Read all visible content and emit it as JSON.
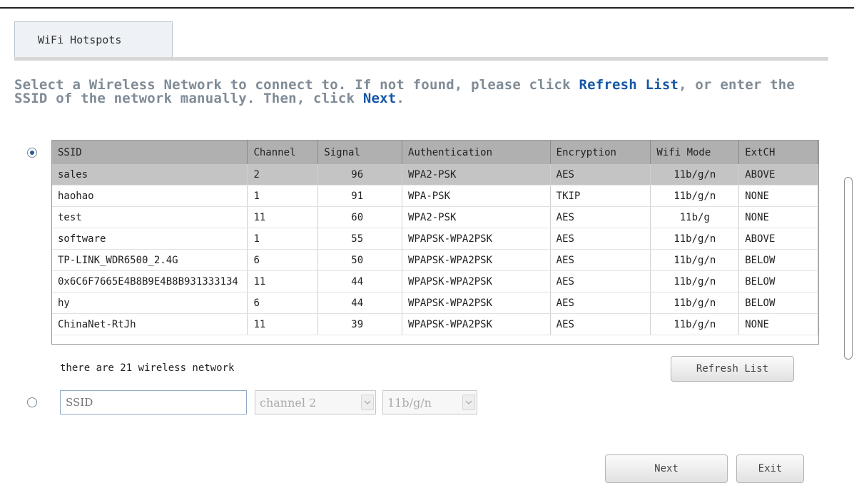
{
  "tab": {
    "label": "WiFi Hotspots"
  },
  "instructions": {
    "part1": "Select a Wireless Network to connect to. If not found, please click ",
    "link1": "Refresh List",
    "part2": ", or enter the SSID of the network manually. Then, click ",
    "link2": "Next",
    "part3": "."
  },
  "table": {
    "columns": [
      "SSID",
      "Channel",
      "Signal",
      "Authentication",
      "Encryption",
      "Wifi Mode",
      "ExtCH"
    ],
    "rows": [
      [
        "sales",
        "2",
        "96",
        "WPA2-PSK",
        "AES",
        "11b/g/n",
        "ABOVE"
      ],
      [
        "haohao",
        "1",
        "91",
        "WPA-PSK",
        "TKIP",
        "11b/g/n",
        "NONE"
      ],
      [
        "test",
        "11",
        "60",
        "WPA2-PSK",
        "AES",
        "11b/g",
        "NONE"
      ],
      [
        "software",
        "1",
        "55",
        "WPAPSK-WPA2PSK",
        "AES",
        "11b/g/n",
        "ABOVE"
      ],
      [
        "TP-LINK_WDR6500_2.4G",
        "6",
        "50",
        "WPAPSK-WPA2PSK",
        "AES",
        "11b/g/n",
        "BELOW"
      ],
      [
        "0x6C6F7665E4B8B9E4B8B931333134",
        "11",
        "44",
        "WPAPSK-WPA2PSK",
        "AES",
        "11b/g/n",
        "BELOW"
      ],
      [
        "hy",
        "6",
        "44",
        "WPAPSK-WPA2PSK",
        "AES",
        "11b/g/n",
        "BELOW"
      ],
      [
        "ChinaNet-RtJh",
        "11",
        "39",
        "WPAPSK-WPA2PSK",
        "AES",
        "11b/g/n",
        "NONE"
      ]
    ],
    "selected_row": 0
  },
  "network_count": "there are 21 wireless network",
  "buttons": {
    "refresh": "Refresh List",
    "next": "Next",
    "exit": "Exit"
  },
  "manual": {
    "ssid_placeholder": "SSID",
    "channel_value": "channel 2",
    "mode_value": "11b/g/n"
  },
  "colors": {
    "accent_link": "#1457a6",
    "instruction_text": "#7f8b96",
    "header_bg": "#b0b0b0",
    "selected_row_bg": "#c4c4c4"
  },
  "icons": {
    "radio_selected": "radio-selected-icon",
    "radio_unselected": "radio-unselected-icon",
    "dropdown": "chevron-down-icon"
  }
}
